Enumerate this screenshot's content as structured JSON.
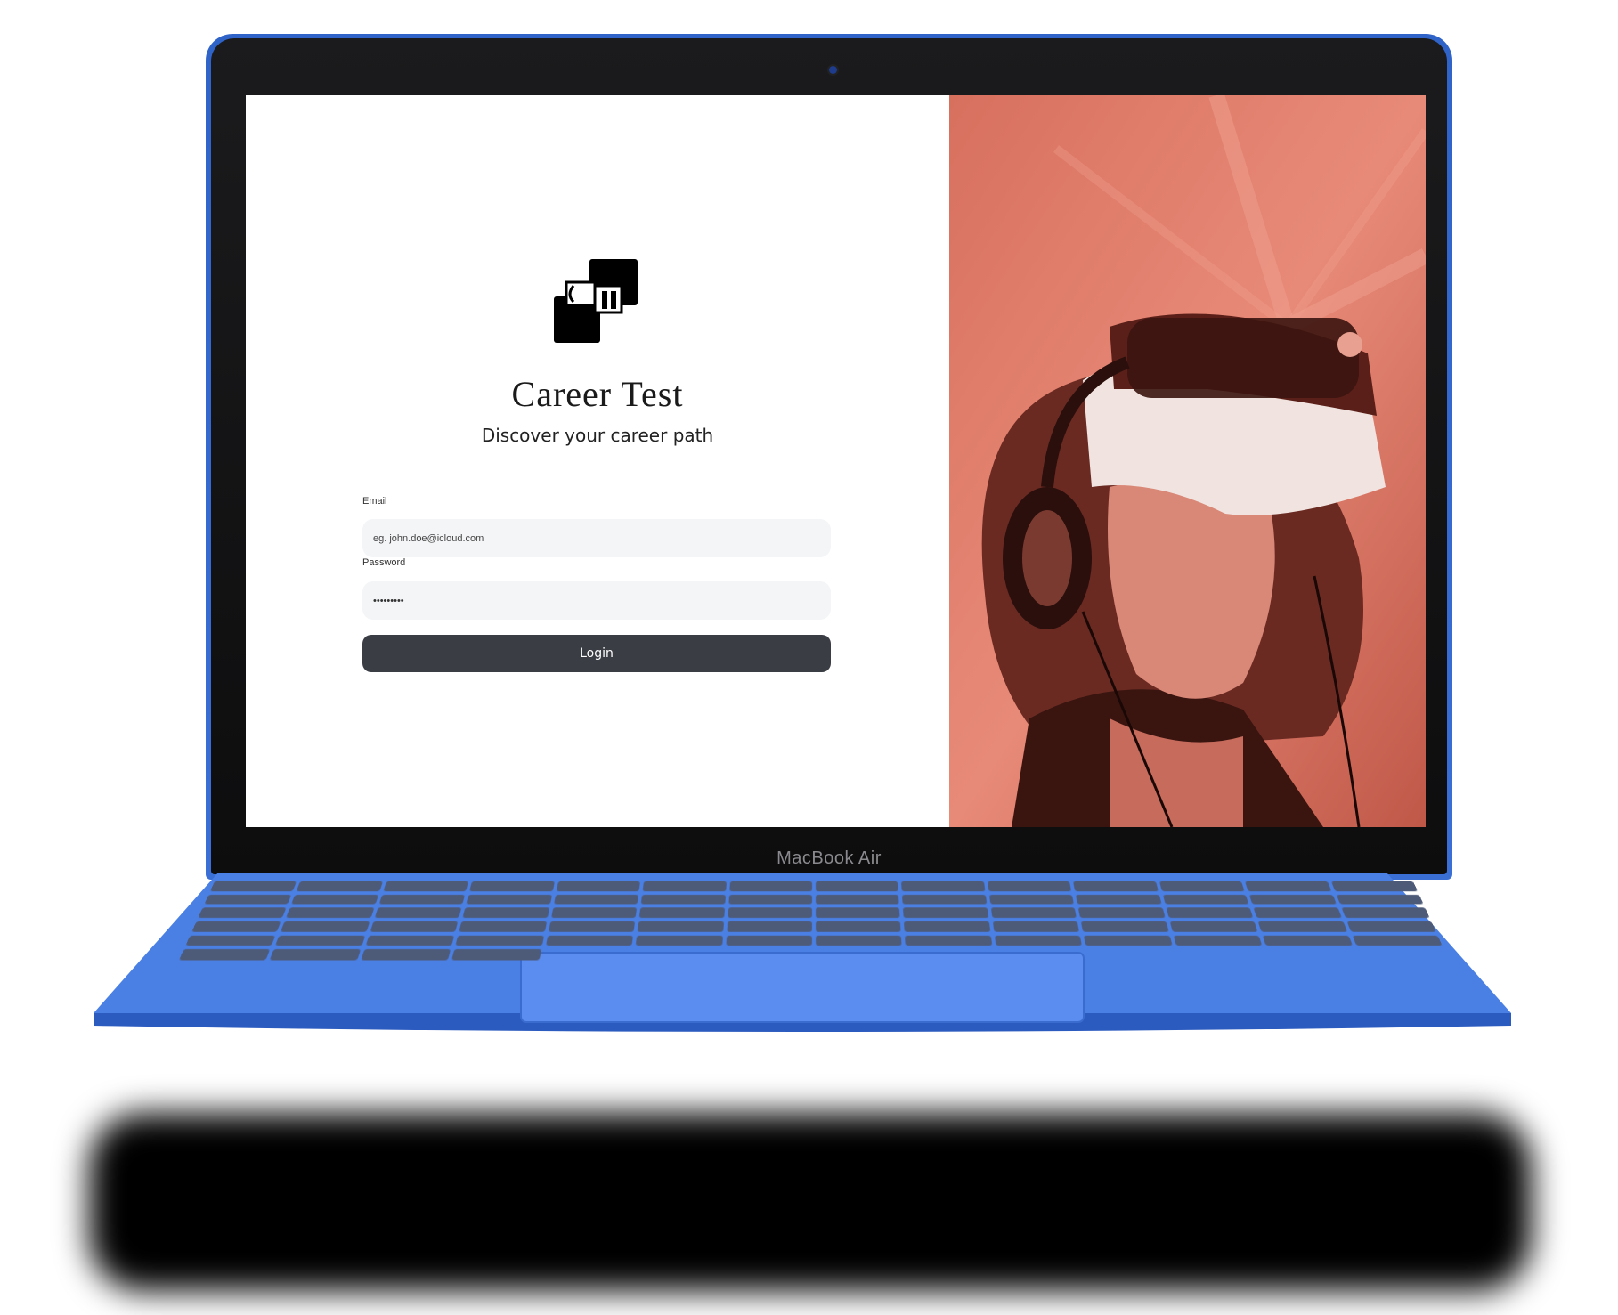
{
  "device": {
    "brand_label": "MacBook Air"
  },
  "login": {
    "title": "Career Test",
    "subtitle": "Discover your career path",
    "email_label": "Email",
    "email_placeholder": "eg. john.doe@icloud.com",
    "password_label": "Password",
    "password_value": "•••••••••",
    "login_button": "Login"
  },
  "colors": {
    "button_bg": "#3a3d44",
    "input_bg": "#f4f5f7",
    "laptop_body": "#3a6fd6",
    "hero_tint": "#e07060"
  },
  "icons": {
    "logo": "career-test-logo"
  }
}
